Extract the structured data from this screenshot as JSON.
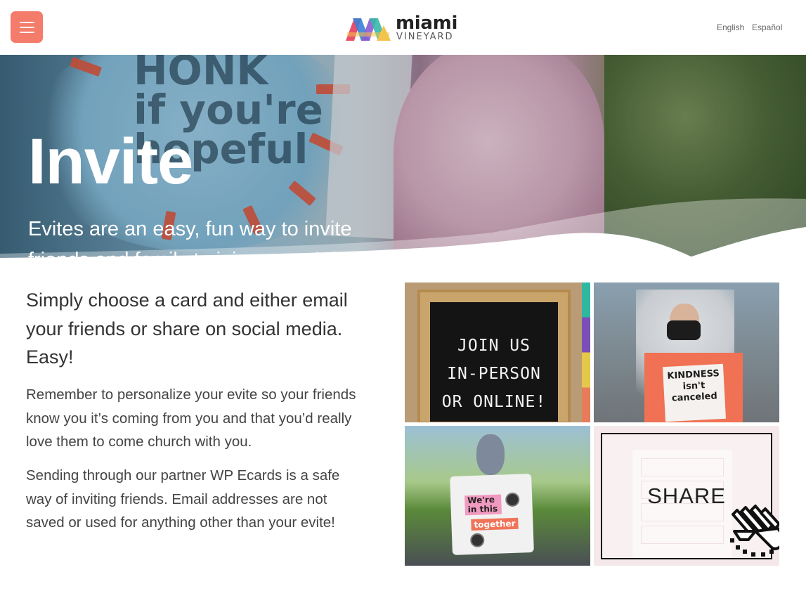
{
  "header": {
    "logo": {
      "word1": "miami",
      "word2": "VINEYARD"
    },
    "languages": [
      "English",
      "Español"
    ]
  },
  "hero": {
    "title": "Invite",
    "subtitle": "Evites are an easy, fun way to invite friends and family to join you at Miami Vineyard!",
    "sign_text": [
      "HONK",
      "if you're",
      "hopeful"
    ]
  },
  "content": {
    "lead": "Simply choose a card and either email your friends or share on social media. Easy!",
    "paragraph_1": "Remember to personalize your evite so your friends know you it’s coming from you and that you’d really love them to come church with you.",
    "paragraph_2": "Sending through our partner WP Ecards is a safe way of inviting friends. Email addresses are not saved or used for anything other than your evite!"
  },
  "cards": [
    {
      "lines": [
        "JOIN US",
        "IN-PERSON",
        "OR ONLINE!"
      ]
    },
    {
      "lines": [
        "KINDNESS",
        "isn't",
        "canceled"
      ]
    },
    {
      "lines": [
        "We're",
        "in this",
        "together"
      ]
    },
    {
      "label": "SHARE"
    }
  ],
  "colors": {
    "accent": "#f47c6b",
    "logo": [
      "#e94f6b",
      "#3a7fd6",
      "#f4c34a",
      "#37b8a8",
      "#8b5bd1"
    ]
  },
  "icons": {
    "menu": "hamburger-icon",
    "share_cursor": "pointer-hand-icon"
  }
}
